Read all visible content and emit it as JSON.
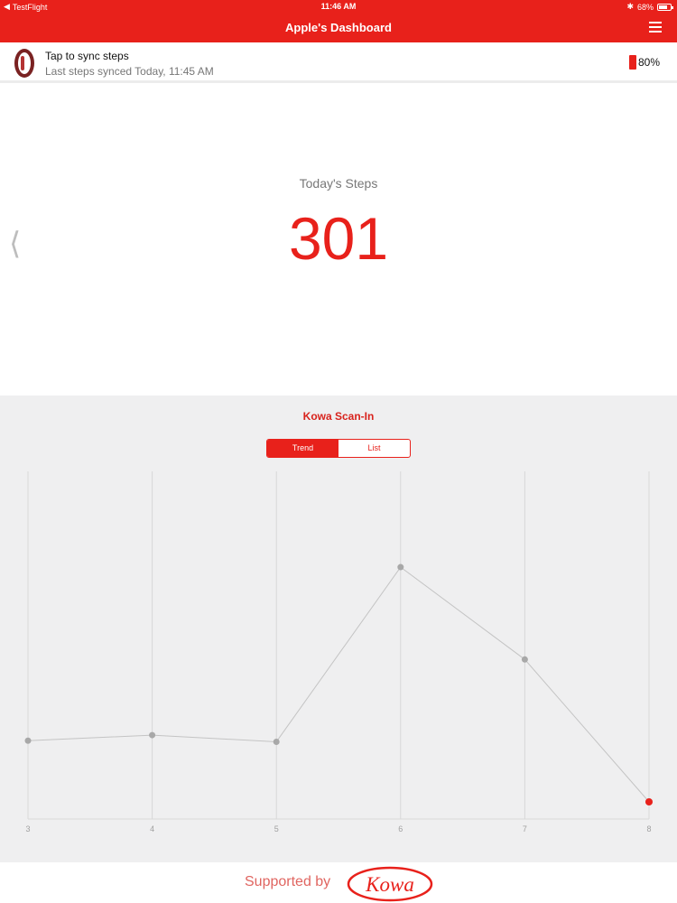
{
  "status_bar": {
    "back_app": "TestFlight",
    "time": "11:46 AM",
    "battery": "68%"
  },
  "nav": {
    "title": "Apple's Dashboard",
    "menu_icon": "hamburger-icon"
  },
  "sync": {
    "title": "Tap to sync steps",
    "subtitle": "Last steps synced Today, 11:45 AM",
    "tracker_battery": "80%"
  },
  "steps": {
    "label": "Today's Steps",
    "value": "301",
    "prev_icon": "chevron-left-icon"
  },
  "panel": {
    "title": "Kowa Scan-In",
    "tabs": [
      {
        "label": "Trend",
        "active": true
      },
      {
        "label": "List",
        "active": false
      }
    ]
  },
  "chart_data": {
    "type": "line",
    "x": [
      3,
      4,
      5,
      6,
      7,
      8
    ],
    "values": [
      55,
      60,
      54,
      211,
      128,
      0
    ],
    "tick_labels": [
      "3",
      "4",
      "5",
      "6",
      "7",
      "8"
    ],
    "ylim": [
      0,
      250
    ],
    "grid": "vertical",
    "line_color": "#c4c4c4",
    "point_color": "#a8a8a8",
    "highlight_color": "#e8211b",
    "highlight_index": 5
  },
  "footer": {
    "supported_by": "Supported by",
    "logo_text": "Kowa"
  },
  "colors": {
    "accent": "#e8211b",
    "panel_bg": "#efeff0"
  }
}
